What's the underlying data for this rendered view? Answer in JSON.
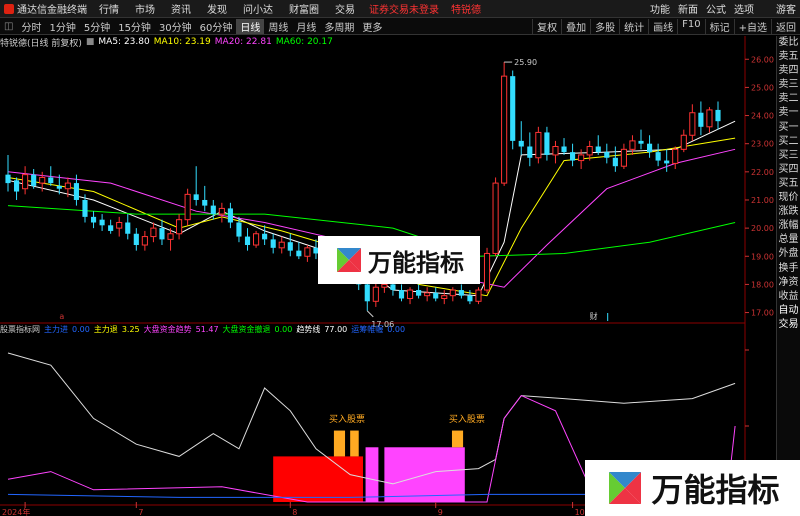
{
  "app": {
    "title": "通达信金融终端",
    "menu": [
      "行情",
      "市场",
      "资讯",
      "发现",
      "问小达",
      "财富圈",
      "交易"
    ],
    "warning": "证券交易未登录",
    "warning2": "特锐德",
    "right_menu": [
      "功能",
      "新面",
      "公式",
      "选项"
    ],
    "user": "游客"
  },
  "periods": {
    "items": [
      "分时",
      "1分钟",
      "5分钟",
      "15分钟",
      "30分钟",
      "60分钟",
      "日线",
      "周线",
      "月线",
      "多周期",
      "更多"
    ],
    "active_index": 6,
    "tools": [
      "复权",
      "叠加",
      "多股",
      "统计",
      "画线",
      "F10",
      "标记",
      "+自选",
      "返回"
    ]
  },
  "main_header": {
    "stock": "特锐德(日线 前复权)",
    "ma5": "MA5: 23.80",
    "ma10": "MA10: 23.19",
    "ma20": "MA20: 22.81",
    "ma60": "MA60: 20.17",
    "colors": {
      "ma5": "#ffffff",
      "ma10": "#ffff00",
      "ma20": "#ff44ff",
      "ma60": "#00ff00"
    }
  },
  "sub_header": {
    "name": "股票指标网",
    "items": [
      {
        "label": "主力进",
        "value": "0.00",
        "color": "#2266ff"
      },
      {
        "label": "主力退",
        "value": "3.25",
        "color": "#ffff00"
      },
      {
        "label": "大盘资金趋势",
        "value": "51.47",
        "color": "#ff44ff"
      },
      {
        "label": "大盘资金撤退",
        "value": "0.00",
        "color": "#00ff00"
      },
      {
        "label": "趋势线",
        "value": "77.00",
        "color": "#ffffff"
      },
      {
        "label": "运筹帷幄",
        "value": "0.00",
        "color": "#2266ff"
      }
    ]
  },
  "sidebar": {
    "items": [
      "委比",
      "卖五",
      "卖四",
      "卖三",
      "卖二",
      "卖一",
      "买一",
      "买二",
      "买三",
      "买四",
      "买五",
      "现价",
      "涨跌",
      "涨幅",
      "总量",
      "外盘",
      "换手",
      "净资",
      "收益",
      "自动",
      "交易"
    ]
  },
  "date_axis": {
    "labels": [
      "2024年",
      "7",
      "8",
      "9",
      "10"
    ]
  },
  "annotations": {
    "buy_label": "买入股票",
    "low_price": "17.06",
    "high_price": "25.90",
    "cai": "财"
  },
  "watermark": {
    "text": "万能指标"
  },
  "chart_data": {
    "type": "candlestick",
    "y_ticks": [
      {
        "value": 26,
        "label": "26.00"
      },
      {
        "value": 25,
        "label": "25.00"
      },
      {
        "value": 24,
        "label": "24.00"
      },
      {
        "value": 23,
        "label": "23.00"
      },
      {
        "value": 22,
        "label": "22.00"
      },
      {
        "value": 21,
        "label": "21.00"
      },
      {
        "value": 20,
        "label": "20.00"
      },
      {
        "value": 19,
        "label": "19.00"
      },
      {
        "value": 18,
        "label": "18.00"
      },
      {
        "value": 17,
        "label": "17.00"
      }
    ],
    "ylim": [
      16.7,
      26.4
    ],
    "candles": [
      [
        21.9,
        22.6,
        21.3,
        21.6
      ],
      [
        21.7,
        21.8,
        21.0,
        21.3
      ],
      [
        21.4,
        22.2,
        21.2,
        21.9
      ],
      [
        21.9,
        22.1,
        21.4,
        21.5
      ],
      [
        21.6,
        22.0,
        21.3,
        21.8
      ],
      [
        21.8,
        22.2,
        21.5,
        21.6
      ],
      [
        21.5,
        21.9,
        21.2,
        21.4
      ],
      [
        21.4,
        21.8,
        21.1,
        21.6
      ],
      [
        21.6,
        21.9,
        20.8,
        21.0
      ],
      [
        21.0,
        21.2,
        20.2,
        20.4
      ],
      [
        20.4,
        20.6,
        20.0,
        20.2
      ],
      [
        20.3,
        20.5,
        19.9,
        20.1
      ],
      [
        20.1,
        20.3,
        19.8,
        19.9
      ],
      [
        20.0,
        20.4,
        19.7,
        20.2
      ],
      [
        20.2,
        20.5,
        19.6,
        19.8
      ],
      [
        19.8,
        20.0,
        19.2,
        19.4
      ],
      [
        19.4,
        19.9,
        19.2,
        19.7
      ],
      [
        19.7,
        20.2,
        19.5,
        20.0
      ],
      [
        20.0,
        20.3,
        19.4,
        19.6
      ],
      [
        19.6,
        20.0,
        19.2,
        19.8
      ],
      [
        19.8,
        20.5,
        19.6,
        20.3
      ],
      [
        20.3,
        21.4,
        20.1,
        21.2
      ],
      [
        21.2,
        22.2,
        20.8,
        21.0
      ],
      [
        21.0,
        21.5,
        20.6,
        20.8
      ],
      [
        20.8,
        21.0,
        20.3,
        20.5
      ],
      [
        20.5,
        20.9,
        20.2,
        20.7
      ],
      [
        20.7,
        20.9,
        20.0,
        20.2
      ],
      [
        20.2,
        20.4,
        19.5,
        19.7
      ],
      [
        19.7,
        20.0,
        19.2,
        19.4
      ],
      [
        19.4,
        19.9,
        19.3,
        19.8
      ],
      [
        19.8,
        20.1,
        19.4,
        19.6
      ],
      [
        19.6,
        19.8,
        19.1,
        19.3
      ],
      [
        19.3,
        19.7,
        19.1,
        19.5
      ],
      [
        19.5,
        19.8,
        19.0,
        19.2
      ],
      [
        19.2,
        19.5,
        18.9,
        19.0
      ],
      [
        19.0,
        19.4,
        18.8,
        19.3
      ],
      [
        19.3,
        19.6,
        18.9,
        19.1
      ],
      [
        19.1,
        19.3,
        18.7,
        18.9
      ],
      [
        18.9,
        19.4,
        18.8,
        19.2
      ],
      [
        19.2,
        19.5,
        18.5,
        18.7
      ],
      [
        18.7,
        18.9,
        18.1,
        18.3
      ],
      [
        18.3,
        18.6,
        17.8,
        18.0
      ],
      [
        18.0,
        18.2,
        17.06,
        17.4
      ],
      [
        17.4,
        18.1,
        17.2,
        17.9
      ],
      [
        17.9,
        18.2,
        17.7,
        18.0
      ],
      [
        18.0,
        18.1,
        17.6,
        17.8
      ],
      [
        17.8,
        18.0,
        17.4,
        17.5
      ],
      [
        17.5,
        17.9,
        17.3,
        17.8
      ],
      [
        17.8,
        18.0,
        17.5,
        17.6
      ],
      [
        17.6,
        17.9,
        17.4,
        17.7
      ],
      [
        17.7,
        17.9,
        17.4,
        17.5
      ],
      [
        17.5,
        17.8,
        17.3,
        17.6
      ],
      [
        17.6,
        17.9,
        17.4,
        17.8
      ],
      [
        17.8,
        18.0,
        17.5,
        17.6
      ],
      [
        17.6,
        17.8,
        17.3,
        17.4
      ],
      [
        17.4,
        17.9,
        17.3,
        17.8
      ],
      [
        17.8,
        19.3,
        17.7,
        19.1
      ],
      [
        19.1,
        21.8,
        19.0,
        21.6
      ],
      [
        21.6,
        25.9,
        21.5,
        25.4
      ],
      [
        25.4,
        25.6,
        22.8,
        23.1
      ],
      [
        23.1,
        23.8,
        22.6,
        22.9
      ],
      [
        22.9,
        23.4,
        22.2,
        22.5
      ],
      [
        22.5,
        23.6,
        22.3,
        23.4
      ],
      [
        23.4,
        23.6,
        22.4,
        22.6
      ],
      [
        22.6,
        23.1,
        22.3,
        22.9
      ],
      [
        22.9,
        23.2,
        22.6,
        22.7
      ],
      [
        22.7,
        23.0,
        22.2,
        22.4
      ],
      [
        22.4,
        22.8,
        22.1,
        22.6
      ],
      [
        22.6,
        23.1,
        22.4,
        22.9
      ],
      [
        22.9,
        23.3,
        22.6,
        22.7
      ],
      [
        22.7,
        23.0,
        22.3,
        22.5
      ],
      [
        22.5,
        22.9,
        22.0,
        22.2
      ],
      [
        22.2,
        23.0,
        22.1,
        22.8
      ],
      [
        22.8,
        23.3,
        22.6,
        23.1
      ],
      [
        23.1,
        23.5,
        22.8,
        23.0
      ],
      [
        23.0,
        23.3,
        22.5,
        22.7
      ],
      [
        22.7,
        23.0,
        22.2,
        22.4
      ],
      [
        22.4,
        22.8,
        22.0,
        22.3
      ],
      [
        22.3,
        22.9,
        22.1,
        22.8
      ],
      [
        22.8,
        23.5,
        22.7,
        23.3
      ],
      [
        23.3,
        24.4,
        23.1,
        24.1
      ],
      [
        24.1,
        24.5,
        23.3,
        23.6
      ],
      [
        23.6,
        24.3,
        23.4,
        24.2
      ],
      [
        24.2,
        24.5,
        23.5,
        23.8
      ]
    ],
    "ma_series": [
      {
        "name": "MA5",
        "color": "#ffffff",
        "values": [
          [
            0,
            21.7
          ],
          [
            10,
            21.0
          ],
          [
            20,
            19.8
          ],
          [
            25,
            20.6
          ],
          [
            30,
            19.9
          ],
          [
            40,
            18.9
          ],
          [
            45,
            17.8
          ],
          [
            55,
            17.6
          ],
          [
            58,
            19.5
          ],
          [
            60,
            22.6
          ],
          [
            70,
            22.7
          ],
          [
            78,
            22.8
          ],
          [
            85,
            23.8
          ]
        ]
      },
      {
        "name": "MA10",
        "color": "#ffff00",
        "values": [
          [
            0,
            21.8
          ],
          [
            10,
            21.3
          ],
          [
            20,
            20.0
          ],
          [
            25,
            20.4
          ],
          [
            32,
            19.9
          ],
          [
            42,
            19.0
          ],
          [
            48,
            18.0
          ],
          [
            56,
            17.6
          ],
          [
            60,
            20.0
          ],
          [
            65,
            22.4
          ],
          [
            75,
            22.7
          ],
          [
            85,
            23.2
          ]
        ]
      },
      {
        "name": "MA20",
        "color": "#ff44ff",
        "values": [
          [
            0,
            22.0
          ],
          [
            12,
            21.6
          ],
          [
            22,
            20.6
          ],
          [
            30,
            20.2
          ],
          [
            40,
            19.5
          ],
          [
            50,
            18.4
          ],
          [
            58,
            17.9
          ],
          [
            63,
            19.4
          ],
          [
            70,
            21.4
          ],
          [
            78,
            22.3
          ],
          [
            85,
            22.8
          ]
        ]
      },
      {
        "name": "MA60",
        "color": "#00ff00",
        "values": [
          [
            0,
            20.8
          ],
          [
            15,
            20.5
          ],
          [
            30,
            20.5
          ],
          [
            45,
            20.0
          ],
          [
            55,
            19.0
          ],
          [
            65,
            19.1
          ],
          [
            75,
            19.5
          ],
          [
            85,
            20.2
          ]
        ]
      }
    ],
    "sub": {
      "white_line": [
        [
          0,
          0.98
        ],
        [
          5,
          0.9
        ],
        [
          10,
          0.55
        ],
        [
          15,
          0.38
        ],
        [
          20,
          0.3
        ],
        [
          24,
          0.45
        ],
        [
          27,
          0.35
        ],
        [
          30,
          0.75
        ],
        [
          33,
          0.6
        ],
        [
          36,
          0.35
        ],
        [
          40,
          0.18
        ],
        [
          45,
          0.12
        ],
        [
          50,
          0.2
        ],
        [
          55,
          0.22
        ],
        [
          57,
          0.28
        ],
        [
          58,
          0.55
        ],
        [
          60,
          0.7
        ],
        [
          65,
          0.68
        ],
        [
          72,
          0.65
        ],
        [
          80,
          0.68
        ],
        [
          85,
          0.78
        ]
      ],
      "magenta_line": [
        [
          0,
          0.15
        ],
        [
          5,
          0.2
        ],
        [
          10,
          0.08
        ],
        [
          25,
          0.1
        ],
        [
          35,
          0.0
        ],
        [
          56,
          0.0
        ],
        [
          58,
          0.55
        ],
        [
          60,
          0.7
        ],
        [
          64,
          0.6
        ],
        [
          68,
          0.1
        ],
        [
          84,
          0.0
        ],
        [
          85,
          0.5
        ]
      ],
      "blue_line": [
        [
          0,
          0.05
        ],
        [
          20,
          0.03
        ],
        [
          40,
          0.03
        ],
        [
          56,
          0.05
        ],
        [
          85,
          0.05
        ]
      ],
      "blocks": [
        {
          "color": "#ff0000",
          "x0": 31,
          "x1": 41.5,
          "y0": 0.0,
          "y1": 0.3
        },
        {
          "color": "#ff44ff",
          "x0": 41.8,
          "x1": 43.3,
          "y0": 0.0,
          "y1": 0.36
        },
        {
          "color": "#ff44ff",
          "x0": 44.0,
          "x1": 53.4,
          "y0": 0.0,
          "y1": 0.36
        },
        {
          "color": "#ffaa22",
          "x0": 38.1,
          "x1": 39.4,
          "y0": 0.3,
          "y1": 0.47
        },
        {
          "color": "#ffaa22",
          "x0": 40.0,
          "x1": 41.0,
          "y0": 0.3,
          "y1": 0.47
        },
        {
          "color": "#ffaa22",
          "x0": 51.9,
          "x1": 53.2,
          "y0": 0.36,
          "y1": 0.47
        }
      ],
      "y_ticks": [
        100,
        50,
        0
      ]
    }
  }
}
